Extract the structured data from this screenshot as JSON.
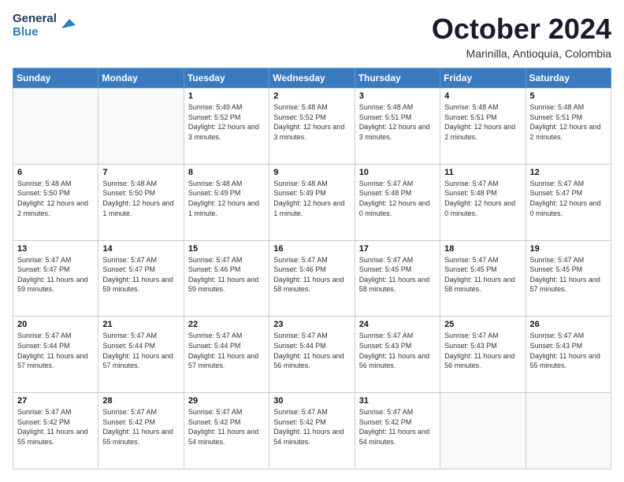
{
  "logo": {
    "line1": "General",
    "line2": "Blue"
  },
  "title": "October 2024",
  "subtitle": "Marinilla, Antioquia, Colombia",
  "weekdays": [
    "Sunday",
    "Monday",
    "Tuesday",
    "Wednesday",
    "Thursday",
    "Friday",
    "Saturday"
  ],
  "weeks": [
    [
      {
        "day": "",
        "info": ""
      },
      {
        "day": "",
        "info": ""
      },
      {
        "day": "1",
        "info": "Sunrise: 5:49 AM\nSunset: 5:52 PM\nDaylight: 12 hours and 3 minutes."
      },
      {
        "day": "2",
        "info": "Sunrise: 5:48 AM\nSunset: 5:52 PM\nDaylight: 12 hours and 3 minutes."
      },
      {
        "day": "3",
        "info": "Sunrise: 5:48 AM\nSunset: 5:51 PM\nDaylight: 12 hours and 3 minutes."
      },
      {
        "day": "4",
        "info": "Sunrise: 5:48 AM\nSunset: 5:51 PM\nDaylight: 12 hours and 2 minutes."
      },
      {
        "day": "5",
        "info": "Sunrise: 5:48 AM\nSunset: 5:51 PM\nDaylight: 12 hours and 2 minutes."
      }
    ],
    [
      {
        "day": "6",
        "info": "Sunrise: 5:48 AM\nSunset: 5:50 PM\nDaylight: 12 hours and 2 minutes."
      },
      {
        "day": "7",
        "info": "Sunrise: 5:48 AM\nSunset: 5:50 PM\nDaylight: 12 hours and 1 minute."
      },
      {
        "day": "8",
        "info": "Sunrise: 5:48 AM\nSunset: 5:49 PM\nDaylight: 12 hours and 1 minute."
      },
      {
        "day": "9",
        "info": "Sunrise: 5:48 AM\nSunset: 5:49 PM\nDaylight: 12 hours and 1 minute."
      },
      {
        "day": "10",
        "info": "Sunrise: 5:47 AM\nSunset: 5:48 PM\nDaylight: 12 hours and 0 minutes."
      },
      {
        "day": "11",
        "info": "Sunrise: 5:47 AM\nSunset: 5:48 PM\nDaylight: 12 hours and 0 minutes."
      },
      {
        "day": "12",
        "info": "Sunrise: 5:47 AM\nSunset: 5:47 PM\nDaylight: 12 hours and 0 minutes."
      }
    ],
    [
      {
        "day": "13",
        "info": "Sunrise: 5:47 AM\nSunset: 5:47 PM\nDaylight: 11 hours and 59 minutes."
      },
      {
        "day": "14",
        "info": "Sunrise: 5:47 AM\nSunset: 5:47 PM\nDaylight: 11 hours and 59 minutes."
      },
      {
        "day": "15",
        "info": "Sunrise: 5:47 AM\nSunset: 5:46 PM\nDaylight: 11 hours and 59 minutes."
      },
      {
        "day": "16",
        "info": "Sunrise: 5:47 AM\nSunset: 5:46 PM\nDaylight: 11 hours and 58 minutes."
      },
      {
        "day": "17",
        "info": "Sunrise: 5:47 AM\nSunset: 5:45 PM\nDaylight: 11 hours and 58 minutes."
      },
      {
        "day": "18",
        "info": "Sunrise: 5:47 AM\nSunset: 5:45 PM\nDaylight: 11 hours and 58 minutes."
      },
      {
        "day": "19",
        "info": "Sunrise: 5:47 AM\nSunset: 5:45 PM\nDaylight: 11 hours and 57 minutes."
      }
    ],
    [
      {
        "day": "20",
        "info": "Sunrise: 5:47 AM\nSunset: 5:44 PM\nDaylight: 11 hours and 57 minutes."
      },
      {
        "day": "21",
        "info": "Sunrise: 5:47 AM\nSunset: 5:44 PM\nDaylight: 11 hours and 57 minutes."
      },
      {
        "day": "22",
        "info": "Sunrise: 5:47 AM\nSunset: 5:44 PM\nDaylight: 11 hours and 57 minutes."
      },
      {
        "day": "23",
        "info": "Sunrise: 5:47 AM\nSunset: 5:44 PM\nDaylight: 11 hours and 56 minutes."
      },
      {
        "day": "24",
        "info": "Sunrise: 5:47 AM\nSunset: 5:43 PM\nDaylight: 11 hours and 56 minutes."
      },
      {
        "day": "25",
        "info": "Sunrise: 5:47 AM\nSunset: 5:43 PM\nDaylight: 11 hours and 56 minutes."
      },
      {
        "day": "26",
        "info": "Sunrise: 5:47 AM\nSunset: 5:43 PM\nDaylight: 11 hours and 55 minutes."
      }
    ],
    [
      {
        "day": "27",
        "info": "Sunrise: 5:47 AM\nSunset: 5:42 PM\nDaylight: 11 hours and 55 minutes."
      },
      {
        "day": "28",
        "info": "Sunrise: 5:47 AM\nSunset: 5:42 PM\nDaylight: 11 hours and 55 minutes."
      },
      {
        "day": "29",
        "info": "Sunrise: 5:47 AM\nSunset: 5:42 PM\nDaylight: 11 hours and 54 minutes."
      },
      {
        "day": "30",
        "info": "Sunrise: 5:47 AM\nSunset: 5:42 PM\nDaylight: 11 hours and 54 minutes."
      },
      {
        "day": "31",
        "info": "Sunrise: 5:47 AM\nSunset: 5:42 PM\nDaylight: 11 hours and 54 minutes."
      },
      {
        "day": "",
        "info": ""
      },
      {
        "day": "",
        "info": ""
      }
    ]
  ]
}
